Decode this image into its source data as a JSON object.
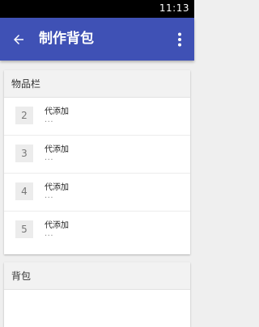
{
  "status_bar": {
    "time": "11:13"
  },
  "app_bar": {
    "title": "制作背包",
    "back_icon": "arrow-back-icon",
    "menu_icon": "more-vert-icon"
  },
  "inventory": {
    "title": "物品栏",
    "slots": [
      {
        "number": "2",
        "label": "代添加",
        "sub": "..."
      },
      {
        "number": "3",
        "label": "代添加",
        "sub": "..."
      },
      {
        "number": "4",
        "label": "代添加",
        "sub": "..."
      },
      {
        "number": "5",
        "label": "代添加",
        "sub": "..."
      }
    ]
  },
  "backpack": {
    "title": "背包"
  },
  "colors": {
    "primary": "#3f51b5",
    "status_bar": "#000000",
    "background": "#efefef"
  }
}
